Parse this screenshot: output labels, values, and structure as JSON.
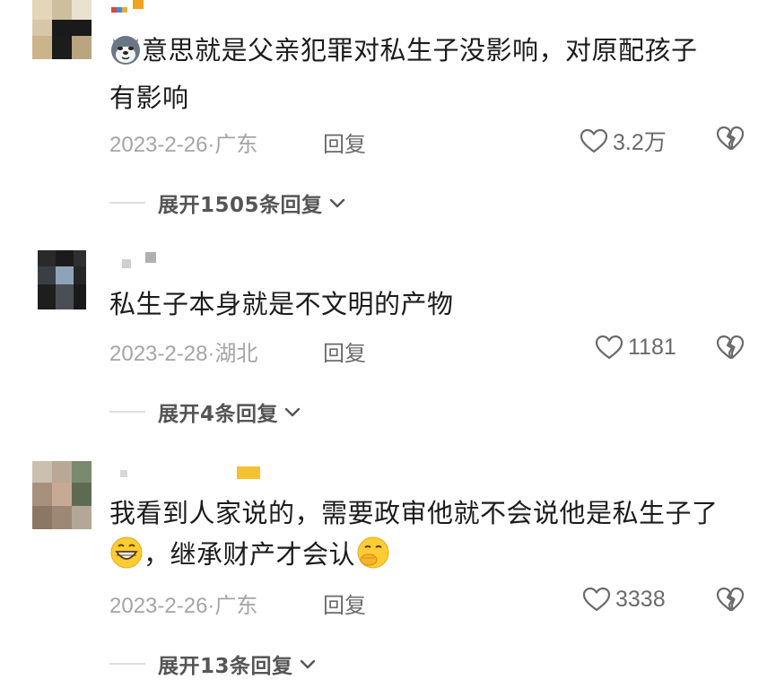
{
  "comments": [
    {
      "text_line1": "意思就是父亲犯罪对私生子没影响，对原配孩子",
      "text_line2": "有影响",
      "date": "2023-2-26·",
      "location": "广东",
      "reply_label": "回复",
      "likes": "3.2万",
      "expand_label": "展开1505条回复",
      "prefix_emoji": "husky-dog-emoji"
    },
    {
      "text_line1": "私生子本身就是不文明的产物",
      "date": "2023-2-28·",
      "location": "湖北",
      "reply_label": "回复",
      "likes": "1181",
      "expand_label": "展开4条回复"
    },
    {
      "text_line1": "我看到人家说的，需要政审他就不会说他是私生子了",
      "text_line2": "，继承财产才会认",
      "date": "2023-2-26·",
      "location": "广东",
      "reply_label": "回复",
      "likes": "3338",
      "expand_label": "展开13条回复",
      "emojis": [
        "grinning-face-emoji",
        "smirking-hand-over-mouth-emoji"
      ]
    }
  ],
  "icons": {
    "like": "heart-outline-icon",
    "dislike": "broken-heart-icon",
    "expand": "chevron-down-icon"
  },
  "colors": {
    "text": "#1c1c1c",
    "meta": "#a5a5a5",
    "action": "#6a6a6a"
  }
}
